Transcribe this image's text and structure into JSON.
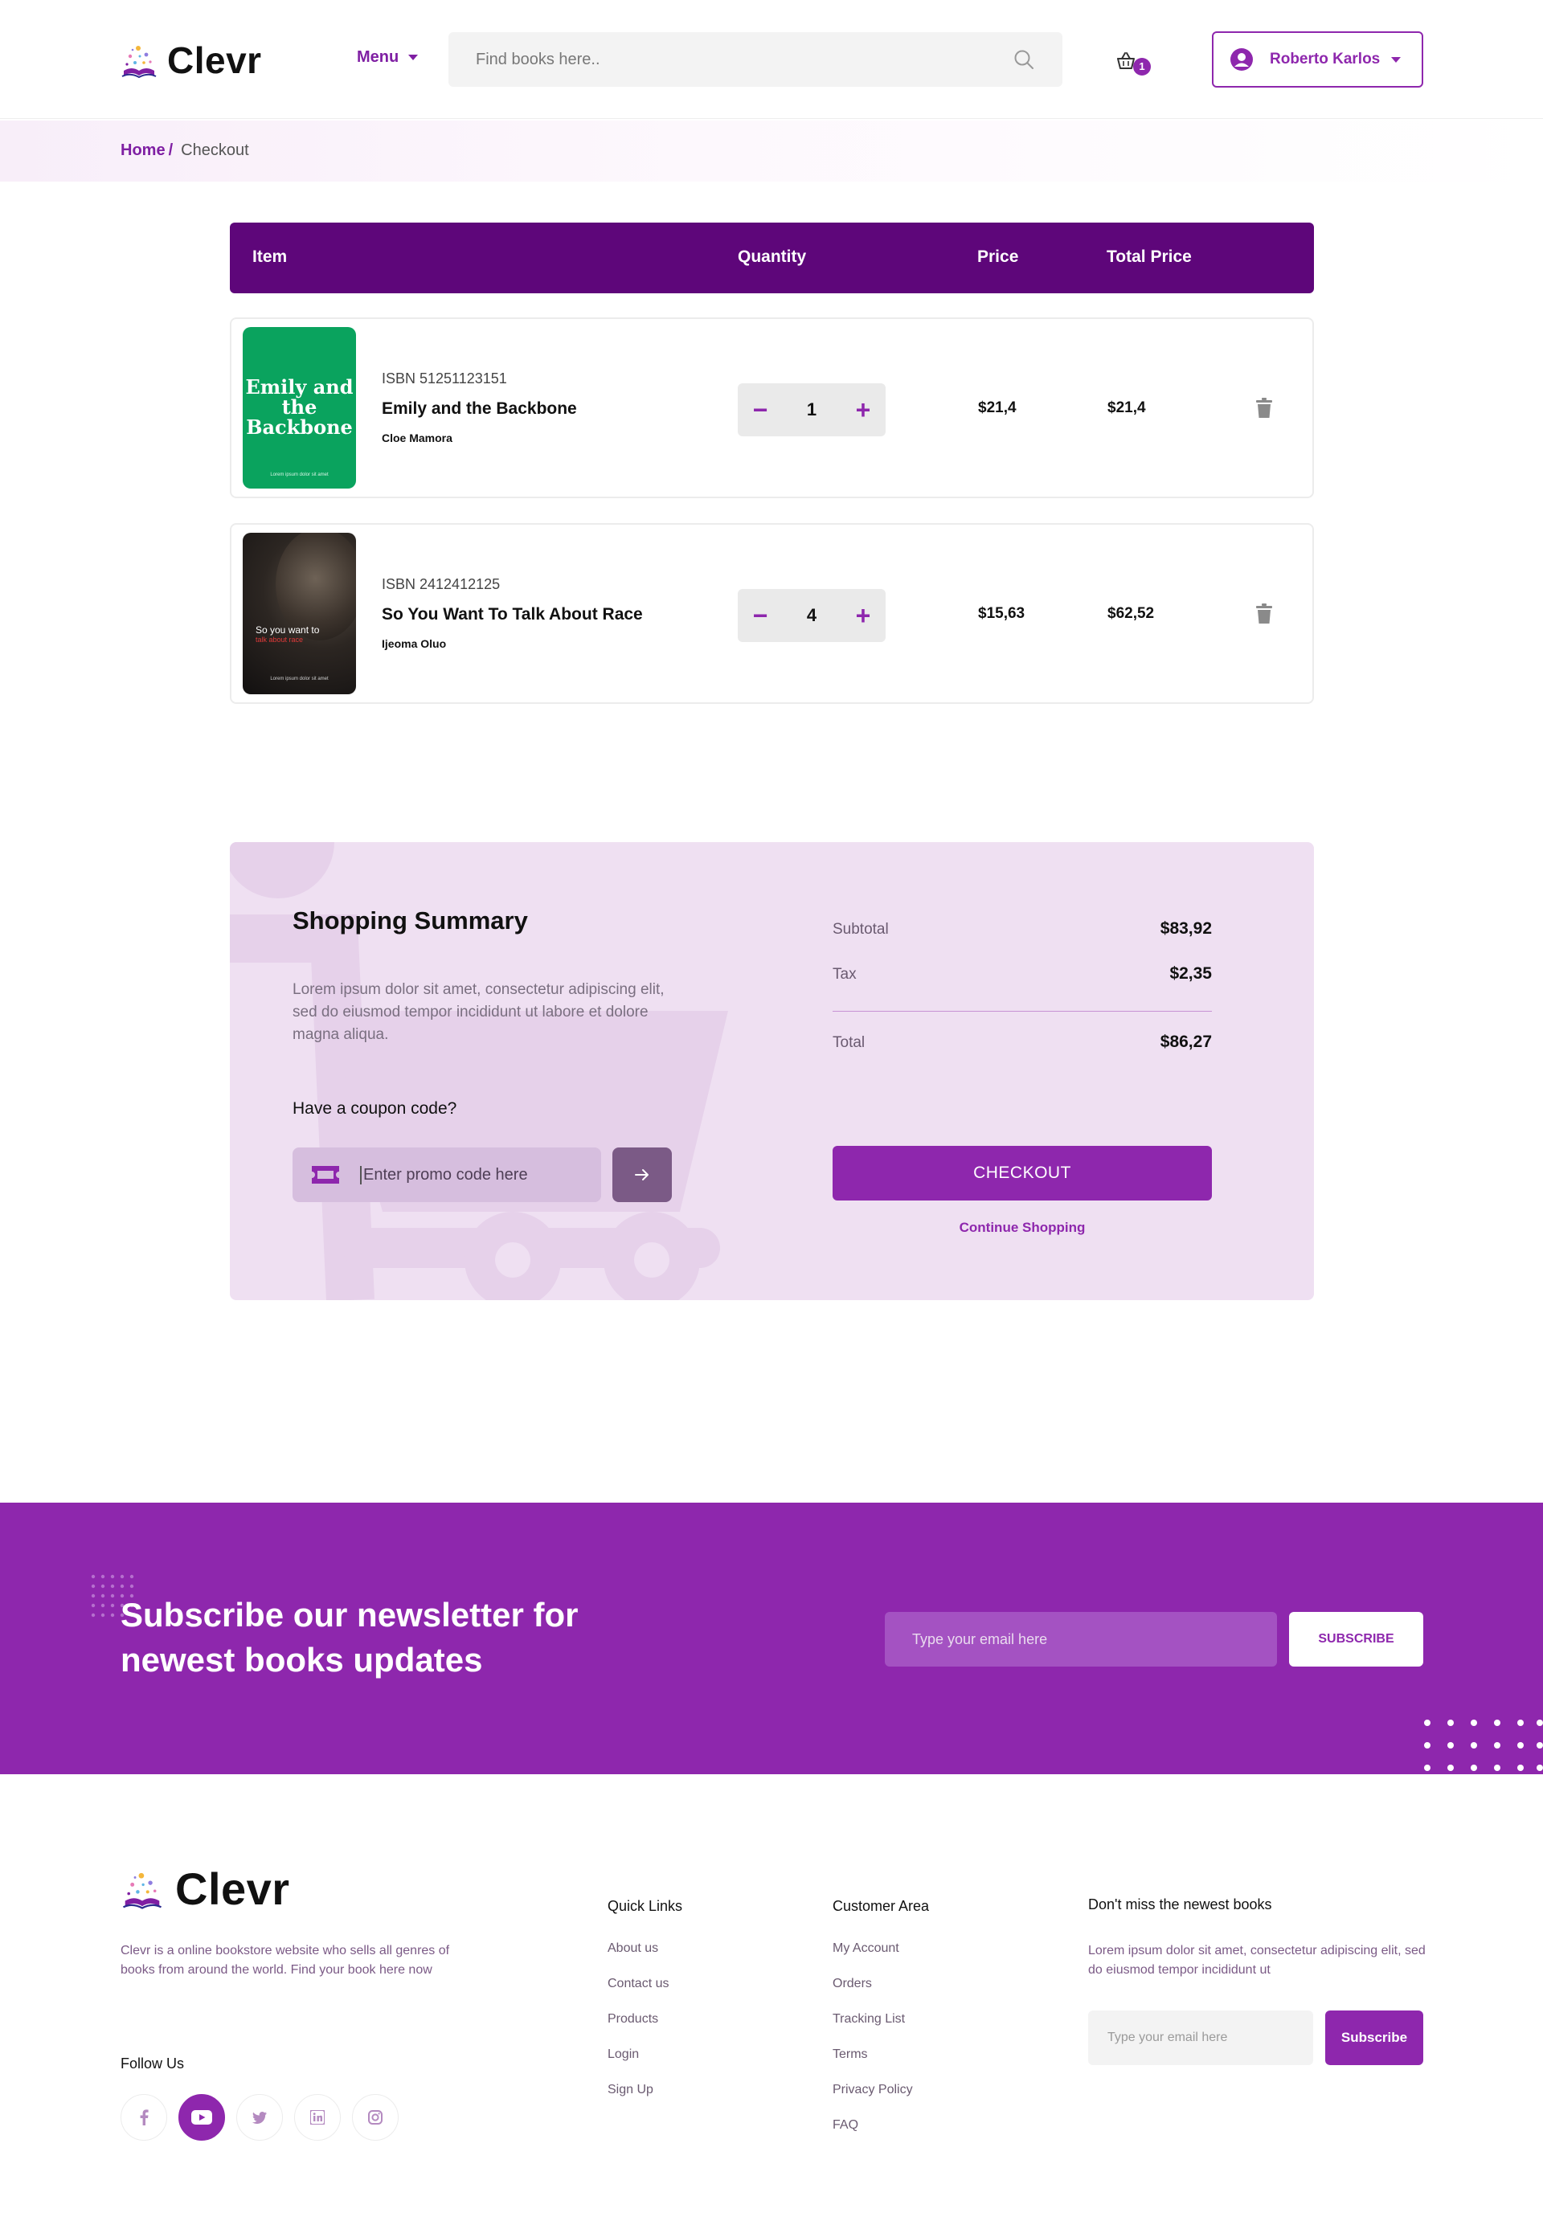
{
  "header": {
    "logo_text": "Clevr",
    "menu_label": "Menu",
    "search_placeholder": "Find books here..",
    "cart_count": "1",
    "user_name": "Roberto Karlos"
  },
  "breadcrumb": {
    "home": "Home",
    "separator": "/",
    "current": "Checkout"
  },
  "cart_table": {
    "headers": {
      "item": "Item",
      "quantity": "Quantity",
      "price": "Price",
      "total_price": "Total Price"
    },
    "rows": [
      {
        "cover_title": "Emily and the Backbone",
        "cover_subtitle": "Lorem ipsum dolor sit amet",
        "isbn": "ISBN 51251123151",
        "title": "Emily and the Backbone",
        "author": "Cloe Mamora",
        "quantity": "1",
        "price": "$21,4",
        "total": "$21,4"
      },
      {
        "cover_title": "So you want to",
        "cover_title_accent": "talk about race",
        "cover_subtitle": "Lorem ipsum dolor sit amet",
        "isbn": "ISBN 2412412125",
        "title": "So You Want To Talk About Race",
        "author": "Ijeoma Oluo",
        "quantity": "4",
        "price": "$15,63",
        "total": "$62,52"
      }
    ],
    "minus_symbol": "−",
    "plus_symbol": "+"
  },
  "summary": {
    "title": "Shopping Summary",
    "description": "Lorem ipsum dolor sit amet, consectetur adipiscing elit, sed do eiusmod tempor incididunt ut labore et dolore magna aliqua.",
    "coupon_label": "Have a coupon code?",
    "promo_placeholder": "Enter promo code here",
    "subtotal_label": "Subtotal",
    "subtotal_value": "$83,92",
    "tax_label": "Tax",
    "tax_value": "$2,35",
    "total_label": "Total",
    "total_value": "$86,27",
    "checkout_label": "CHECKOUT",
    "continue_label": "Continue Shopping"
  },
  "newsletter": {
    "title": "Subscribe our newsletter for newest books updates",
    "email_placeholder": "Type your email here",
    "button_label": "SUBSCRIBE"
  },
  "footer": {
    "logo_text": "Clevr",
    "description": "Clevr is a online bookstore website who sells all genres of books from around the world. Find your book here now",
    "follow_label": "Follow Us",
    "social_icons": [
      "facebook-icon",
      "youtube-icon",
      "twitter-icon",
      "linkedin-icon",
      "instagram-icon"
    ],
    "quick_links": {
      "title": "Quick Links",
      "items": [
        "About us",
        "Contact us",
        "Products",
        "Login",
        "Sign Up"
      ]
    },
    "customer_area": {
      "title": "Customer Area",
      "items": [
        "My Account",
        "Orders",
        "Tracking List",
        "Terms",
        "Privacy Policy",
        "FAQ"
      ]
    },
    "newsletter": {
      "title": "Don't miss the newest books",
      "description": "Lorem ipsum dolor sit amet, consectetur adipiscing elit, sed do eiusmod tempor incididunt ut",
      "email_placeholder": "Type your email here",
      "button_label": "Subscribe"
    }
  },
  "colors": {
    "brand_purple": "#8e27ad",
    "table_header": "#5e067a",
    "summary_bg": "#efe0f2",
    "newsletter_bg": "#8e27ad"
  }
}
